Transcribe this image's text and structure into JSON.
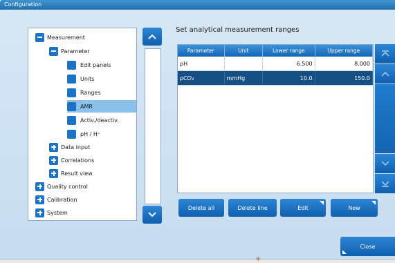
{
  "window": {
    "title": "Configuration"
  },
  "tree": [
    {
      "label": "Measurement",
      "type": "minus"
    },
    {
      "label": "Parameter",
      "type": "minus"
    },
    {
      "label": "Edit panels",
      "type": "leaf"
    },
    {
      "label": "Units",
      "type": "leaf"
    },
    {
      "label": "Ranges",
      "type": "leaf"
    },
    {
      "label": "AMR",
      "type": "leaf"
    },
    {
      "label": "Activ./deactiv.",
      "type": "leaf"
    },
    {
      "label": "pH / H⁺",
      "type": "leaf"
    },
    {
      "label": "Data input",
      "type": "plus"
    },
    {
      "label": "Correlations",
      "type": "plus"
    },
    {
      "label": "Result view",
      "type": "plus"
    },
    {
      "label": "Quality control",
      "type": "plus"
    },
    {
      "label": "Calibration",
      "type": "plus"
    },
    {
      "label": "System",
      "type": "plus"
    }
  ],
  "panel": {
    "title": "Set analytical measurement ranges",
    "columns": [
      "Parameter",
      "Unit",
      "Lower range",
      "Upper range"
    ],
    "rows": [
      [
        "pH",
        "",
        "6.500",
        "8.000"
      ],
      [
        "pCO₂",
        "mmHg",
        "10.0",
        "150.0"
      ]
    ],
    "buttons": {
      "delete_all": "Delete all",
      "delete_line": "Delete line",
      "edit": "Edit",
      "new": "New"
    },
    "close": "Close"
  },
  "icons": {
    "scroll_up": "chevron-up-icon",
    "scroll_down": "chevron-down-icon",
    "first": "double-chevron-up-icon",
    "last": "double-chevron-down-icon"
  },
  "colors": {
    "accent": "#1c73c6",
    "selected_row": "#164f83",
    "selected_tree": "#8ac0ea"
  }
}
